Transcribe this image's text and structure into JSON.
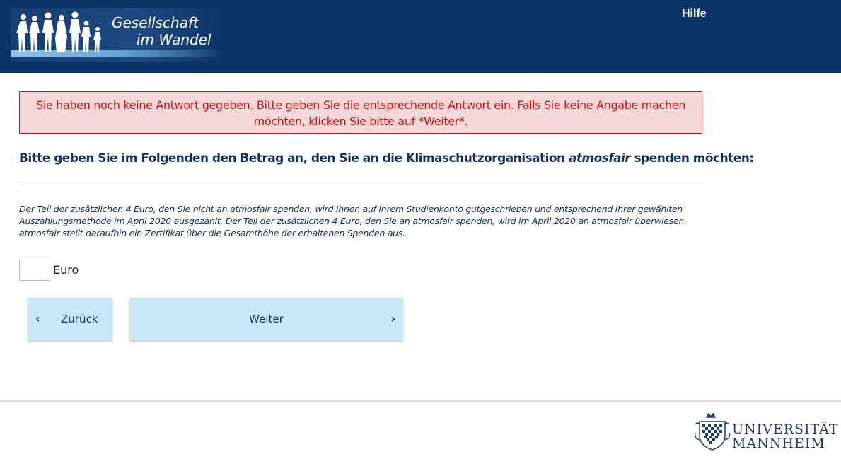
{
  "header": {
    "logo_line1": "Gesellschaft",
    "logo_line2": "im Wandel",
    "help_label": "Hilfe"
  },
  "error": {
    "message": "Sie haben noch keine Antwort gegeben. Bitte geben Sie die entsprechende Antwort ein. Falls Sie keine Angabe machen möchten, klicken Sie bitte auf *Weiter*."
  },
  "question": {
    "text_before": "Bitte geben Sie im Folgenden den Betrag an, den Sie an die Klimaschutzorganisation ",
    "emphasis": "atmosfair",
    "text_after": " spenden möchten:"
  },
  "info": {
    "text": "Der Teil der zusätzlichen 4 Euro, den Sie nicht an atmosfair spenden, wird Ihnen auf Ihrem Studienkonto gutgeschrieben und entsprechend Ihrer gewählten Auszahlungsmethode im April 2020 ausgezahlt. Der Teil der zusätzlichen 4 Euro, den Sie an atmosfair spenden, wird im April 2020 an atmosfair überwiesen. atmosfair stellt daraufhin ein Zertifikat über die Gesamthöhe der erhaltenen Spenden aus."
  },
  "amount": {
    "value": "",
    "unit_label": "Euro"
  },
  "navigation": {
    "back_label": "Zurück",
    "next_label": "Weiter",
    "back_icon": "chevron-left-icon",
    "next_icon": "chevron-right-icon"
  },
  "footer": {
    "university_line1": "UNIVERSITÄT",
    "university_line2": "MANNHEIM"
  },
  "colors": {
    "header_bg": "#0d3466",
    "error_bg": "#f4d7d7",
    "error_text": "#c81414",
    "button_bg": "#c6e8f7",
    "text_navy": "#14305e"
  }
}
